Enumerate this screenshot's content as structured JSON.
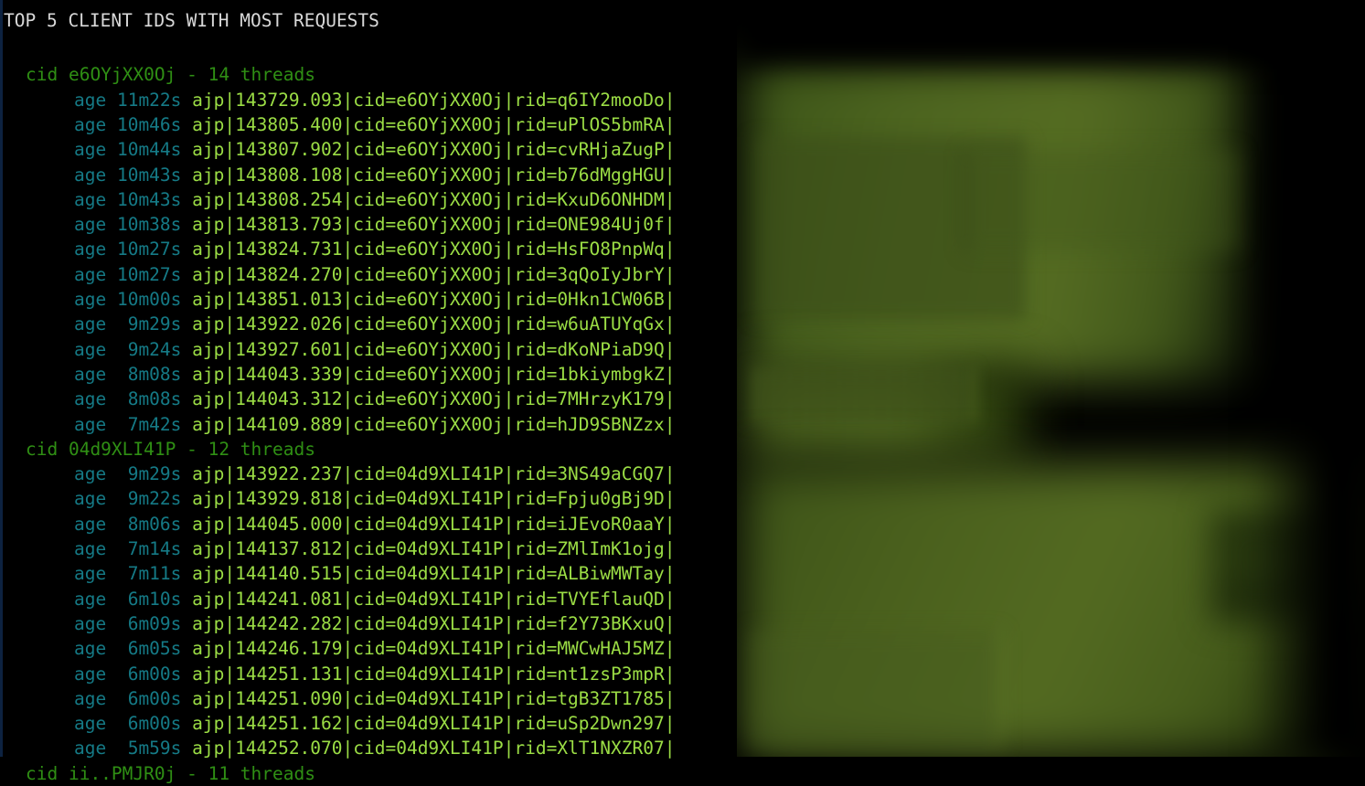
{
  "terminal": {
    "title": "TOP 5 CLIENT IDS WITH MOST REQUESTS",
    "colors": {
      "background": "#000000",
      "title_text": "#d8d8d8",
      "cid_header": "#2f8f14",
      "age_label": "#157a86",
      "thread_text": "#9bdd45",
      "cursor_bar": "#0d2240",
      "blur_green": "#4c641f"
    },
    "blank_line_after_title": true,
    "sections": [
      {
        "cid_label": "cid",
        "cid": "e6OYjXX0Oj",
        "separator": "-",
        "thread_count": "14",
        "thread_word": "threads",
        "header_text": "cid e6OYjXX0Oj - 14 threads",
        "rows": [
          {
            "age_text": "age 11m22s",
            "age_label": "age",
            "age_value": "11m22s",
            "thread": "ajp|143729.093|cid=e6OYjXX0Oj|rid=q6IY2mooDo|",
            "protocol": "ajp",
            "thread_id": "143729.093",
            "cid": "e6OYjXX0Oj",
            "rid": "q6IY2mooDo"
          },
          {
            "age_text": "age 10m46s",
            "age_label": "age",
            "age_value": "10m46s",
            "thread": "ajp|143805.400|cid=e6OYjXX0Oj|rid=uPlOS5bmRA|",
            "protocol": "ajp",
            "thread_id": "143805.400",
            "cid": "e6OYjXX0Oj",
            "rid": "uPlOS5bmRA"
          },
          {
            "age_text": "age 10m44s",
            "age_label": "age",
            "age_value": "10m44s",
            "thread": "ajp|143807.902|cid=e6OYjXX0Oj|rid=cvRHjaZugP|",
            "protocol": "ajp",
            "thread_id": "143807.902",
            "cid": "e6OYjXX0Oj",
            "rid": "cvRHjaZugP"
          },
          {
            "age_text": "age 10m43s",
            "age_label": "age",
            "age_value": "10m43s",
            "thread": "ajp|143808.108|cid=e6OYjXX0Oj|rid=b76dMggHGU|",
            "protocol": "ajp",
            "thread_id": "143808.108",
            "cid": "e6OYjXX0Oj",
            "rid": "b76dMggHGU"
          },
          {
            "age_text": "age 10m43s",
            "age_label": "age",
            "age_value": "10m43s",
            "thread": "ajp|143808.254|cid=e6OYjXX0Oj|rid=KxuD6ONHDM|",
            "protocol": "ajp",
            "thread_id": "143808.254",
            "cid": "e6OYjXX0Oj",
            "rid": "KxuD6ONHDM"
          },
          {
            "age_text": "age 10m38s",
            "age_label": "age",
            "age_value": "10m38s",
            "thread": "ajp|143813.793|cid=e6OYjXX0Oj|rid=ONE984Uj0f|",
            "protocol": "ajp",
            "thread_id": "143813.793",
            "cid": "e6OYjXX0Oj",
            "rid": "ONE984Uj0f"
          },
          {
            "age_text": "age 10m27s",
            "age_label": "age",
            "age_value": "10m27s",
            "thread": "ajp|143824.731|cid=e6OYjXX0Oj|rid=HsFO8PnpWq|",
            "protocol": "ajp",
            "thread_id": "143824.731",
            "cid": "e6OYjXX0Oj",
            "rid": "HsFO8PnpWq"
          },
          {
            "age_text": "age 10m27s",
            "age_label": "age",
            "age_value": "10m27s",
            "thread": "ajp|143824.270|cid=e6OYjXX0Oj|rid=3qQoIyJbrY|",
            "protocol": "ajp",
            "thread_id": "143824.270",
            "cid": "e6OYjXX0Oj",
            "rid": "3qQoIyJbrY"
          },
          {
            "age_text": "age 10m00s",
            "age_label": "age",
            "age_value": "10m00s",
            "thread": "ajp|143851.013|cid=e6OYjXX0Oj|rid=0Hkn1CW06B|",
            "protocol": "ajp",
            "thread_id": "143851.013",
            "cid": "e6OYjXX0Oj",
            "rid": "0Hkn1CW06B"
          },
          {
            "age_text": "age  9m29s",
            "age_label": "age",
            "age_value": "9m29s",
            "thread": "ajp|143922.026|cid=e6OYjXX0Oj|rid=w6uATUYqGx|",
            "protocol": "ajp",
            "thread_id": "143922.026",
            "cid": "e6OYjXX0Oj",
            "rid": "w6uATUYqGx"
          },
          {
            "age_text": "age  9m24s",
            "age_label": "age",
            "age_value": "9m24s",
            "thread": "ajp|143927.601|cid=e6OYjXX0Oj|rid=dKoNPiaD9Q|",
            "protocol": "ajp",
            "thread_id": "143927.601",
            "cid": "e6OYjXX0Oj",
            "rid": "dKoNPiaD9Q"
          },
          {
            "age_text": "age  8m08s",
            "age_label": "age",
            "age_value": "8m08s",
            "thread": "ajp|144043.339|cid=e6OYjXX0Oj|rid=1bkiymbgkZ|",
            "protocol": "ajp",
            "thread_id": "144043.339",
            "cid": "e6OYjXX0Oj",
            "rid": "1bkiymbgkZ"
          },
          {
            "age_text": "age  8m08s",
            "age_label": "age",
            "age_value": "8m08s",
            "thread": "ajp|144043.312|cid=e6OYjXX0Oj|rid=7MHrzyK179|",
            "protocol": "ajp",
            "thread_id": "144043.312",
            "cid": "e6OYjXX0Oj",
            "rid": "7MHrzyK179"
          },
          {
            "age_text": "age  7m42s",
            "age_label": "age",
            "age_value": "7m42s",
            "thread": "ajp|144109.889|cid=e6OYjXX0Oj|rid=hJD9SBNZzx|",
            "protocol": "ajp",
            "thread_id": "144109.889",
            "cid": "e6OYjXX0Oj",
            "rid": "hJD9SBNZzx"
          }
        ]
      },
      {
        "cid_label": "cid",
        "cid": "04d9XLI41P",
        "separator": "-",
        "thread_count": "12",
        "thread_word": "threads",
        "header_text": "cid 04d9XLI41P - 12 threads",
        "rows": [
          {
            "age_text": "age  9m29s",
            "age_label": "age",
            "age_value": "9m29s",
            "thread": "ajp|143922.237|cid=04d9XLI41P|rid=3NS49aCGQ7|",
            "protocol": "ajp",
            "thread_id": "143922.237",
            "cid": "04d9XLI41P",
            "rid": "3NS49aCGQ7"
          },
          {
            "age_text": "age  9m22s",
            "age_label": "age",
            "age_value": "9m22s",
            "thread": "ajp|143929.818|cid=04d9XLI41P|rid=Fpju0gBj9D|",
            "protocol": "ajp",
            "thread_id": "143929.818",
            "cid": "04d9XLI41P",
            "rid": "Fpju0gBj9D"
          },
          {
            "age_text": "age  8m06s",
            "age_label": "age",
            "age_value": "8m06s",
            "thread": "ajp|144045.000|cid=04d9XLI41P|rid=iJEvoR0aaY|",
            "protocol": "ajp",
            "thread_id": "144045.000",
            "cid": "04d9XLI41P",
            "rid": "iJEvoR0aaY"
          },
          {
            "age_text": "age  7m14s",
            "age_label": "age",
            "age_value": "7m14s",
            "thread": "ajp|144137.812|cid=04d9XLI41P|rid=ZMlImK1ojg|",
            "protocol": "ajp",
            "thread_id": "144137.812",
            "cid": "04d9XLI41P",
            "rid": "ZMlImK1ojg"
          },
          {
            "age_text": "age  7m11s",
            "age_label": "age",
            "age_value": "7m11s",
            "thread": "ajp|144140.515|cid=04d9XLI41P|rid=ALBiwMWTay|",
            "protocol": "ajp",
            "thread_id": "144140.515",
            "cid": "04d9XLI41P",
            "rid": "ALBiwMWTay"
          },
          {
            "age_text": "age  6m10s",
            "age_label": "age",
            "age_value": "6m10s",
            "thread": "ajp|144241.081|cid=04d9XLI41P|rid=TVYEflauQD|",
            "protocol": "ajp",
            "thread_id": "144241.081",
            "cid": "04d9XLI41P",
            "rid": "TVYEflauQD"
          },
          {
            "age_text": "age  6m09s",
            "age_label": "age",
            "age_value": "6m09s",
            "thread": "ajp|144242.282|cid=04d9XLI41P|rid=f2Y73BKxuQ|",
            "protocol": "ajp",
            "thread_id": "144242.282",
            "cid": "04d9XLI41P",
            "rid": "f2Y73BKxuQ"
          },
          {
            "age_text": "age  6m05s",
            "age_label": "age",
            "age_value": "6m05s",
            "thread": "ajp|144246.179|cid=04d9XLI41P|rid=MWCwHAJ5MZ|",
            "protocol": "ajp",
            "thread_id": "144246.179",
            "cid": "04d9XLI41P",
            "rid": "MWCwHAJ5MZ"
          },
          {
            "age_text": "age  6m00s",
            "age_label": "age",
            "age_value": "6m00s",
            "thread": "ajp|144251.131|cid=04d9XLI41P|rid=nt1zsP3mpR|",
            "protocol": "ajp",
            "thread_id": "144251.131",
            "cid": "04d9XLI41P",
            "rid": "nt1zsP3mpR"
          },
          {
            "age_text": "age  6m00s",
            "age_label": "age",
            "age_value": "6m00s",
            "thread": "ajp|144251.090|cid=04d9XLI41P|rid=tgB3ZT1785|",
            "protocol": "ajp",
            "thread_id": "144251.090",
            "cid": "04d9XLI41P",
            "rid": "tgB3ZT1785"
          },
          {
            "age_text": "age  6m00s",
            "age_label": "age",
            "age_value": "6m00s",
            "thread": "ajp|144251.162|cid=04d9XLI41P|rid=uSp2Dwn297|",
            "protocol": "ajp",
            "thread_id": "144251.162",
            "cid": "04d9XLI41P",
            "rid": "uSp2Dwn297"
          },
          {
            "age_text": "age  5m59s",
            "age_label": "age",
            "age_value": "5m59s",
            "thread": "ajp|144252.070|cid=04d9XLI41P|rid=XlT1NXZR07|",
            "protocol": "ajp",
            "thread_id": "144252.070",
            "cid": "04d9XLI41P",
            "rid": "XlT1NXZR07"
          }
        ]
      }
    ],
    "truncated_bottom_line": {
      "header_text": "cid ii..PMJR0j - 11 threads",
      "note": "clipped at bottom edge of viewport"
    }
  }
}
